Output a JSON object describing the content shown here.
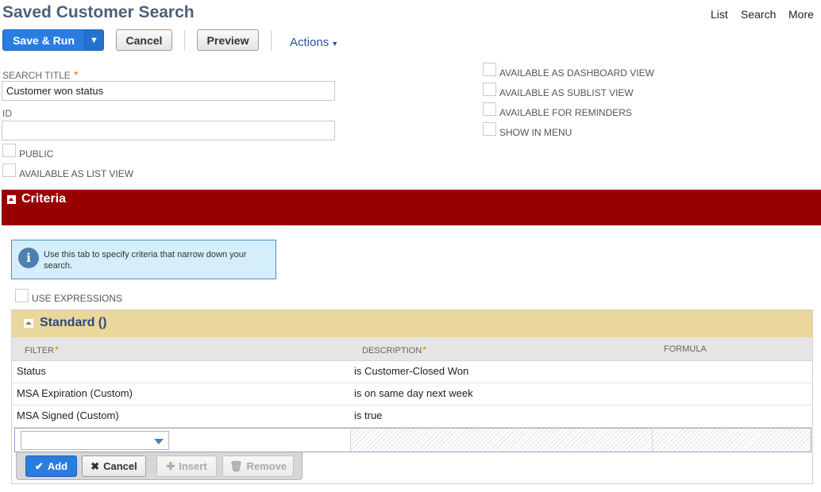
{
  "header": {
    "title": "Saved Customer Search",
    "links": [
      "List",
      "Search",
      "More"
    ]
  },
  "toolbar": {
    "save_run_label": "Save & Run",
    "cancel_label": "Cancel",
    "preview_label": "Preview",
    "actions_label": "Actions"
  },
  "form": {
    "search_title_label": "SEARCH TITLE",
    "search_title_value": "Customer won status",
    "id_label": "ID",
    "id_value": "",
    "public_label": "PUBLIC",
    "list_view_label": "AVAILABLE AS LIST VIEW",
    "right_checkboxes": [
      "AVAILABLE AS DASHBOARD VIEW",
      "AVAILABLE AS SUBLIST VIEW",
      "AVAILABLE FOR REMINDERS",
      "SHOW IN MENU"
    ]
  },
  "criteria": {
    "section_title": "Criteria",
    "info_text": "Use this tab to specify criteria that narrow down your search.",
    "use_expressions_label": "USE EXPRESSIONS",
    "standard_title": "Standard ()",
    "columns": {
      "filter": "FILTER",
      "description": "DESCRIPTION",
      "formula": "FORMULA"
    },
    "rows": [
      {
        "filter": "Status",
        "description": "is Customer-Closed Won",
        "formula": ""
      },
      {
        "filter": "MSA Expiration (Custom)",
        "description": "is on same day next week",
        "formula": ""
      },
      {
        "filter": "MSA Signed (Custom)",
        "description": "is true",
        "formula": ""
      }
    ],
    "buttons": {
      "add": "Add",
      "cancel": "Cancel",
      "insert": "Insert",
      "remove": "Remove"
    }
  },
  "colors": {
    "criteria_bar": "#990000",
    "standard_header": "#e9d79b",
    "primary_button": "#2a7de0",
    "title_text": "#4d5f79"
  },
  "icons": [
    "info-icon",
    "checkmark-icon",
    "x-icon",
    "plus-icon",
    "trash-icon",
    "chevron-down-icon"
  ]
}
